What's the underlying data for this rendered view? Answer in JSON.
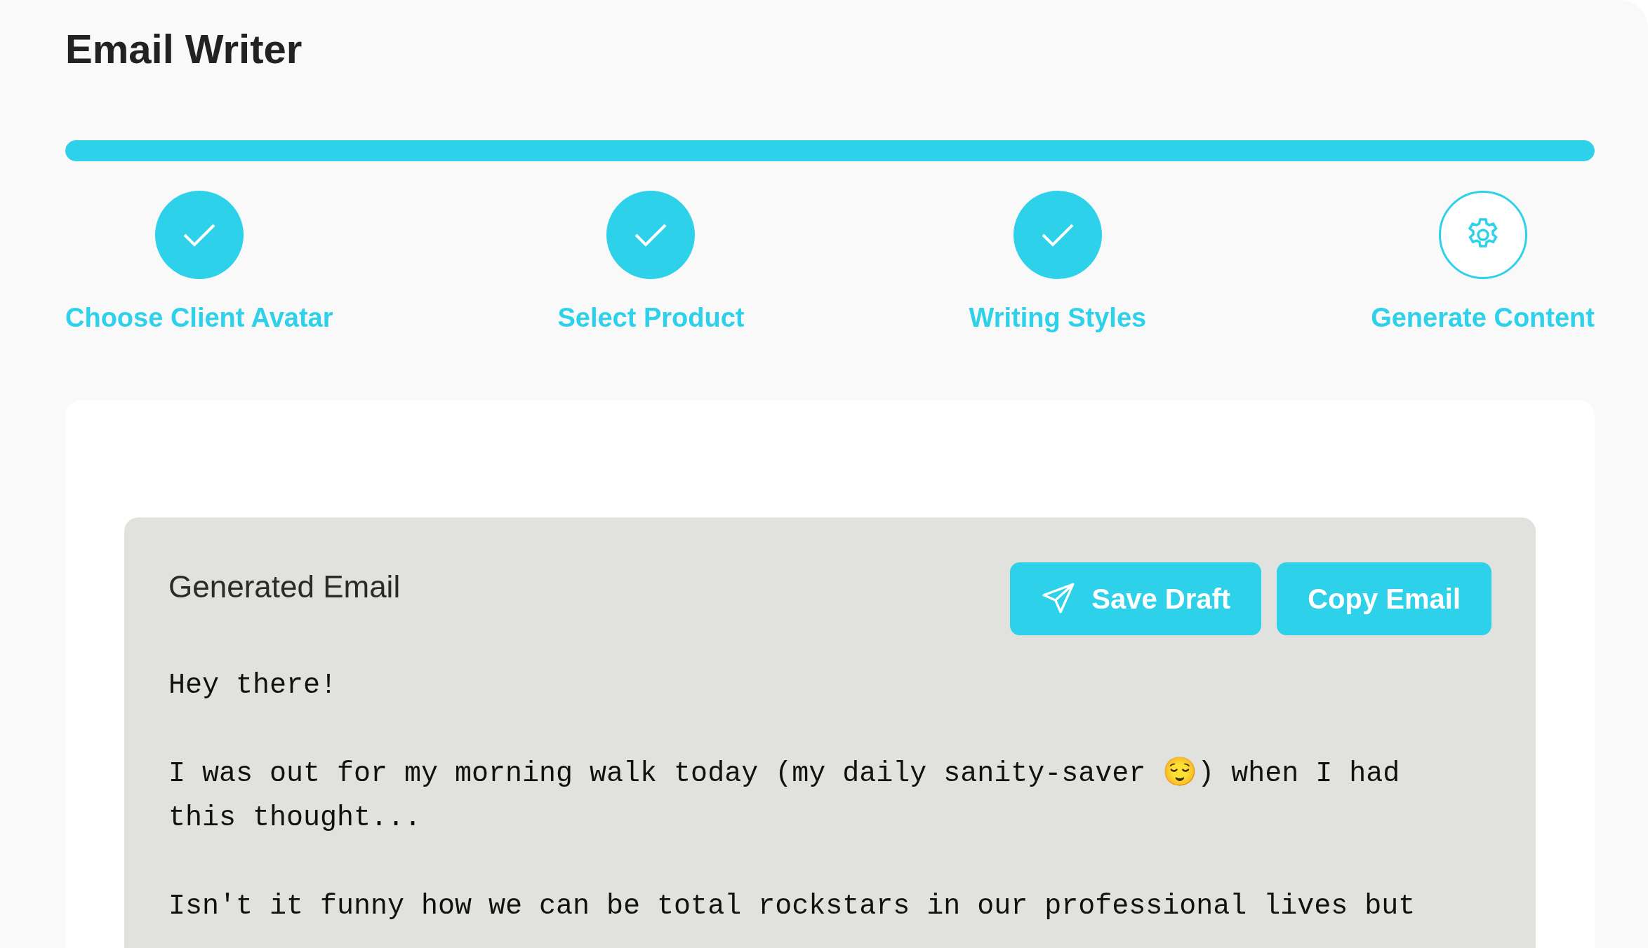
{
  "title": "Email Writer",
  "progress": {
    "level": 1.0
  },
  "steps": [
    {
      "label": "Choose Client Avatar",
      "done": true
    },
    {
      "label": "Select Product",
      "done": true
    },
    {
      "label": "Writing Styles",
      "done": true
    },
    {
      "label": "Generate Content",
      "done": false
    }
  ],
  "result": {
    "heading": "Generated Email",
    "buttons": [
      {
        "label": "Save Draft",
        "kind": "send"
      },
      {
        "label": "Copy Email",
        "kind": "plain"
      }
    ],
    "paragraphs": [
      "Hey there!",
      "I was out for my morning walk today (my daily sanity-saver 😌) when I had this thought...",
      "Isn't it funny how we can be total rockstars in our professional lives but"
    ]
  }
}
